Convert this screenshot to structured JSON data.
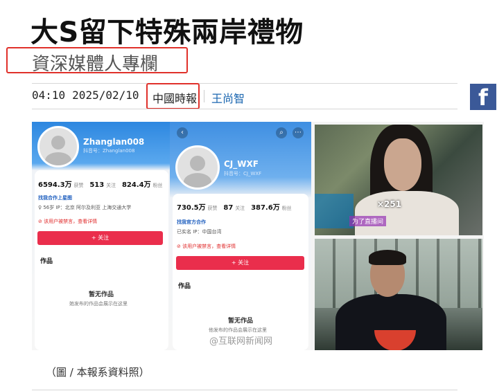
{
  "article": {
    "title": "大S留下特殊兩岸禮物",
    "subtitle": "資深媒體人專欄",
    "time": "04:10",
    "date": "2025/02/10",
    "source": "中國時報",
    "author": "王尚智",
    "caption": "（圖 / 本報系資料照）"
  },
  "share": {
    "facebook_label": "f"
  },
  "colors": {
    "highlight_border": "#e0302a",
    "author_link": "#1a66b0",
    "facebook_bg": "#3b5998",
    "follow_button": "#ea2e4c"
  },
  "image": {
    "profile1": {
      "username": "Zhanglan008",
      "id": "抖音号：Zhanglan008",
      "likes_value": "6594.3万",
      "likes_label": "获赞",
      "following_value": "513",
      "following_label": "关注",
      "followers_value": "824.4万",
      "followers_label": "粉丝",
      "cooperation": "找我合作上星图",
      "info": "♀ 56岁   IP：北京   阿尔及利亚   上海交通大学",
      "warning": "该用户被禁言，查看详情",
      "follow": "+ 关注",
      "works": "作品",
      "empty_title": "暂无作品",
      "empty_sub": "她发布的作品会展示在这里"
    },
    "profile2": {
      "username": "CJ_WXF",
      "id": "抖音号：CJ_WXF",
      "likes_value": "730.5万",
      "likes_label": "获赞",
      "following_value": "87",
      "following_label": "关注",
      "followers_value": "387.6万",
      "followers_label": "粉丝",
      "cooperation": "找我官方合作",
      "info": "已实名   IP：中国台湾",
      "warning": "该用户被禁言，查看详情",
      "follow": "+ 关注",
      "works": "作品",
      "empty_title": "暂无作品",
      "empty_sub": "他发布的作品会展示在这里"
    },
    "watermark": "@互联网新闻网",
    "live_badge": "×251",
    "live_caption": "为了直播间"
  }
}
